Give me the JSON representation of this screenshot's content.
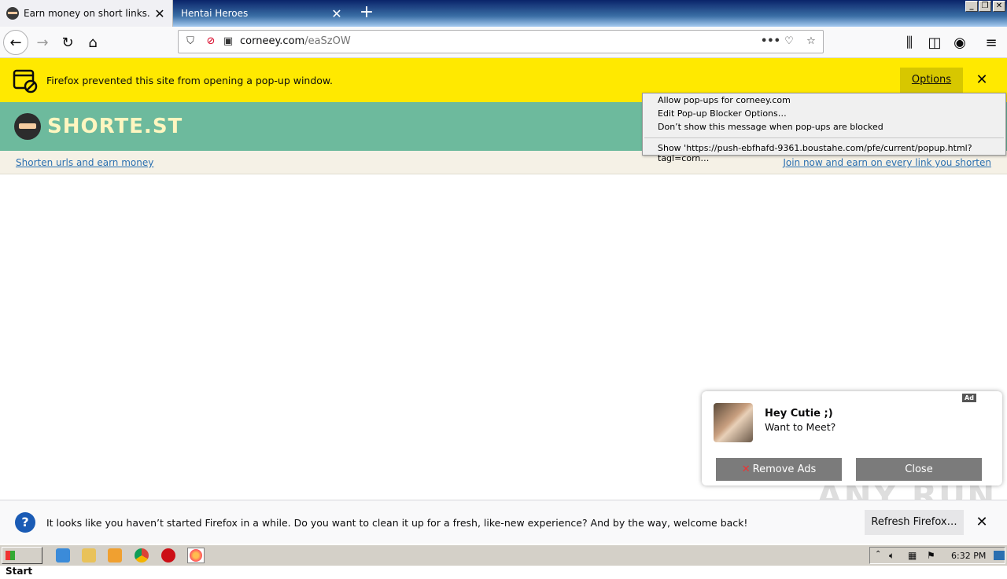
{
  "tabs": [
    {
      "title": "Earn money on short links. Make sh",
      "selected": true
    },
    {
      "title": "Hentai Heroes",
      "selected": false
    }
  ],
  "window_controls": {
    "minimize": "_",
    "restore": "❐",
    "close": "✕"
  },
  "urlbar": {
    "host": "corneey.com",
    "path": "/eaSzOW"
  },
  "popup_notification": {
    "message": "Firefox prevented this site from opening a pop-up window.",
    "options_label": "Options"
  },
  "popup_menu": {
    "items": [
      "Allow pop-ups for corneey.com",
      "Edit Pop-up Blocker Options…",
      "Don’t show this message when pop-ups are blocked",
      "Show 'https://push-ebfhafd-9361.boustahe.com/pfe/current/popup.html?tagl=corn…"
    ]
  },
  "site": {
    "name": "SHORTE.ST",
    "left_link": "Shorten urls and earn money",
    "right_link": "Join now and earn on every link you shorten"
  },
  "ad": {
    "badge": "Ad",
    "title": "Hey Cutie ;)",
    "text": "Want to Meet?",
    "remove_label": "Remove Ads",
    "close_label": "Close"
  },
  "refresh_bar": {
    "message": "It looks like you haven’t started Firefox in a while. Do you want to clean it up for a fresh, like-new experience? And by the way, welcome back!",
    "button_label": "Refresh Firefox…"
  },
  "watermark": "ANY RUN",
  "taskbar": {
    "start_label": "Start",
    "clock": "6:32 PM",
    "icons": [
      "ie-icon",
      "folder-icon",
      "media-player-icon",
      "chrome-icon",
      "opera-icon",
      "firefox-icon"
    ]
  },
  "colors": {
    "notification_yellow": "#ffe900",
    "site_green": "#6dba9d",
    "link_blue": "#2a6fb0"
  }
}
